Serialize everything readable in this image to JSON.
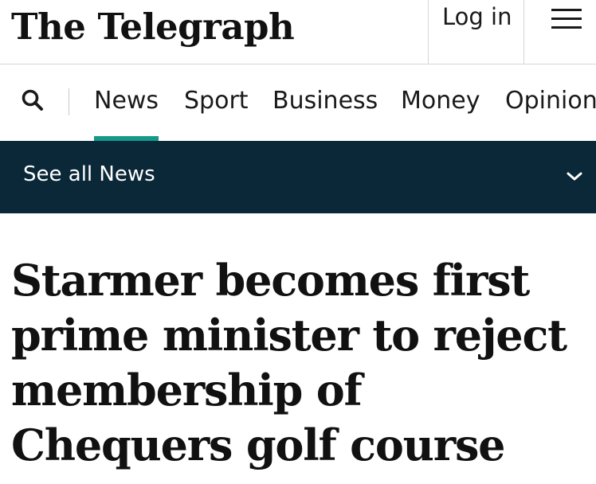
{
  "header": {
    "logo_text": "The Telegraph",
    "login_label": "Log in",
    "menu_icon": "hamburger-icon"
  },
  "nav": {
    "search_icon": "search-icon",
    "items": [
      {
        "label": "News",
        "active": true
      },
      {
        "label": "Sport",
        "active": false
      },
      {
        "label": "Business",
        "active": false
      },
      {
        "label": "Money",
        "active": false
      },
      {
        "label": "Opinion",
        "active": false
      }
    ],
    "accent_color": "#13998a"
  },
  "subnav": {
    "label": "See all News",
    "icon": "chevron-down-icon",
    "background": "#0b2839"
  },
  "article": {
    "headline": "Starmer becomes first prime minister to reject membership of Chequers golf course"
  }
}
